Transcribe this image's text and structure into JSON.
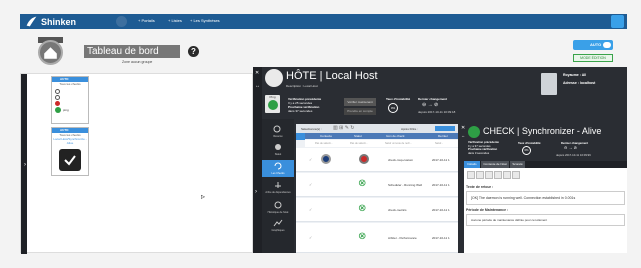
{
  "brand": {
    "name": "Shinken"
  },
  "nav": {
    "portails": "+ Portails",
    "listes": "+ Listes",
    "synth": "+ Les Synthèses"
  },
  "dashboard": {
    "title": "Tableau de bord",
    "subtitle": "Zone aucun groupe",
    "auto": "AUTO",
    "edit": "MODE ÉDITION"
  },
  "widgets": [
    {
      "header": "AUTO",
      "title": "Tous les checks",
      "items": [
        "ok",
        "warn",
        "crit",
        "ping"
      ]
    },
    {
      "header": "AUTO",
      "title": "Tous les checks",
      "sub": "Local Host/Synchronize - Alive"
    }
  ],
  "host": {
    "title": "HÔTE",
    "name": "Local Host",
    "desc": "Description : Local Host",
    "realm_label": "Royaume : All",
    "address_label": "Adresse : localhost",
    "last_check": "Vérification précédente",
    "last_check_ago": "Il y a 25 secondes",
    "next_check": "Prochaine vérification",
    "next_check_in": "dans 37 secondes",
    "btn_check": "Vérifier maintenant",
    "btn_ack": "Prendre en compte",
    "instability": "Taux d'instabilité",
    "instability_val": "0%",
    "last_change": "Dernier changement",
    "since": "depuis 2017-10-11 10:09:18",
    "ping": "Ping"
  },
  "list": {
    "selection": "Sélectionné(s) :",
    "page": "Après Filtre :",
    "columns": [
      "Contexte",
      "Statut",
      "Icon de check",
      "Dernier"
    ],
    "filters": [
      "Pas de sélecti...",
      "Pas de sélecti...",
      "Saisir un texte de rech...",
      "Saisir..."
    ],
    "rows": [
      {
        "name": "check-msp-custom",
        "date": "2017-10-11 1"
      },
      {
        "name": "Scheduler - Running Well",
        "date": "2017-10-11 1"
      },
      {
        "name": "check-metrics",
        "date": "2017-10-11 1"
      },
      {
        "name": "Arbiter - Performance",
        "date": "2017-10-11 1"
      }
    ]
  },
  "sidebar": [
    {
      "label": "Résumé"
    },
    {
      "label": "Statut"
    },
    {
      "label": "Les Checks"
    },
    {
      "label": "Arbre de dépendances"
    },
    {
      "label": "Historique de l'état"
    },
    {
      "label": "Graphiques"
    }
  ],
  "check": {
    "title": "CHECK",
    "name": "Synchronizer - Alive",
    "last_check": "Vérification précédente",
    "last_check_ago": "Il y a 37 secondes",
    "next_check": "Prochaine vérification",
    "next_check_in": "dans 3 secondes",
    "instability": "Taux d'instabilité",
    "instability_val": "0%",
    "last_change": "Dernier changement",
    "since": "depuis 2017-10-11 10:09:96",
    "tabs": [
      "Détails",
      "Contexte de l'état",
      "Scoreté"
    ],
    "output_label": "Texte de retour :",
    "output": "[OK] The daemon is running well. Connection established in 0.001s",
    "maint_label": "Période de Maintenance :",
    "maint": "Aucune période de maintenance définie pour cet élément"
  },
  "colors": {
    "primary": "#1e5b93",
    "accent": "#3aa0e8",
    "ok": "#2e9f45",
    "crit": "#cc2a2a",
    "dark": "#2a2d33"
  }
}
